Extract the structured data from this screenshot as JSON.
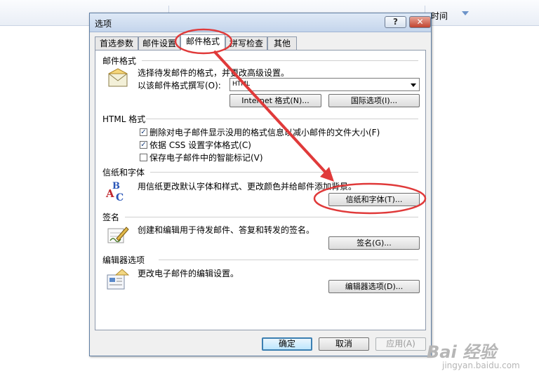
{
  "background": {
    "column_title": "时间"
  },
  "dialog": {
    "title": "选项",
    "help_label": "?",
    "close_label": "✕",
    "tabs": [
      {
        "label": "首选参数"
      },
      {
        "label": "邮件设置"
      },
      {
        "label": "邮件格式"
      },
      {
        "label": "拼写检查"
      },
      {
        "label": "其他"
      }
    ],
    "active_tab": "邮件格式",
    "message_format": {
      "header": "邮件格式",
      "description": "选择待发邮件的格式，并更改高级设置。",
      "compose_label": "以该邮件格式撰写(O):",
      "compose_value": "HTML",
      "internet_format_button": "Internet 格式(N)...",
      "international_button": "国际选项(I)..."
    },
    "html_format": {
      "header": "HTML 格式",
      "options": [
        {
          "label": "删除对电子邮件显示没用的格式信息以减小邮件的文件大小(F)",
          "checked": true
        },
        {
          "label": "依据 CSS 设置字体格式(C)",
          "checked": true
        },
        {
          "label": "保存电子邮件中的智能标记(V)",
          "checked": false
        }
      ]
    },
    "stationery": {
      "header": "信纸和字体",
      "description": "用信纸更改默认字体和样式、更改颜色并给邮件添加背景。",
      "button": "信纸和字体(T)..."
    },
    "signatures": {
      "header": "签名",
      "description": "创建和编辑用于待发邮件、答复和转发的签名。",
      "button": "签名(G)..."
    },
    "editor": {
      "header": "编辑器选项",
      "description": "更改电子邮件的编辑设置。",
      "button": "编辑器选项(D)..."
    },
    "ok_button": "确定",
    "cancel_button": "取消",
    "apply_button": "应用(A)"
  },
  "watermark": {
    "main": "Bai 经验",
    "sub": "jingyan.baidu.com"
  },
  "colors": {
    "annotation_red": "#e03a3a",
    "dialog_border": "#5f7ea3"
  }
}
